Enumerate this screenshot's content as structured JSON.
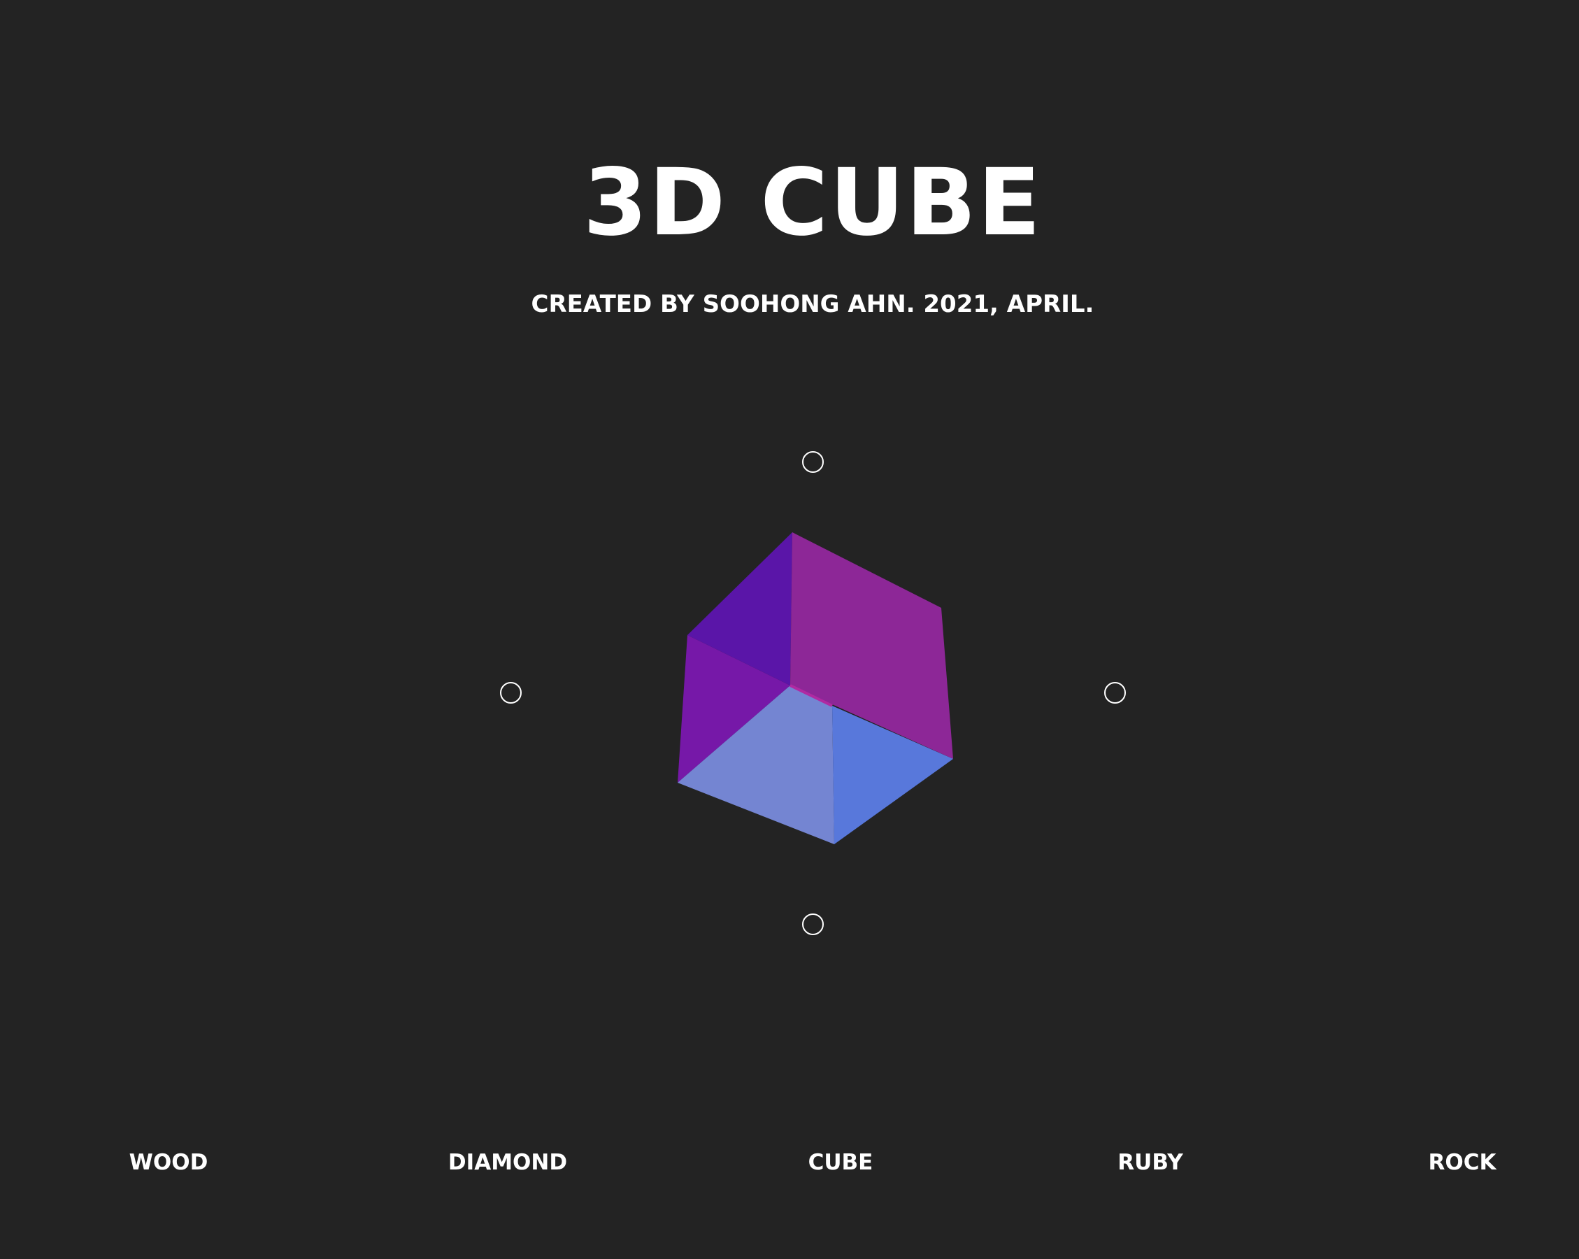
{
  "header": {
    "title": "3D CUBE",
    "subtitle": "CREATED BY SOOHONG AHN. 2021, APRIL."
  },
  "controls": [
    {
      "name": "rotate-up"
    },
    {
      "name": "rotate-left"
    },
    {
      "name": "rotate-right"
    },
    {
      "name": "rotate-down"
    }
  ],
  "cube": {
    "colors": {
      "top_left": "#5a15a8",
      "top_right": "#8d2797",
      "left_side": "#7618a8",
      "bottom_left": "#7485d2",
      "bottom_right": "#5878db",
      "edge_highlight": "#b02aa2"
    }
  },
  "menu": {
    "items": [
      "WOOD",
      "DIAMOND",
      "CUBE",
      "RUBY",
      "ROCK"
    ]
  },
  "colors": {
    "background": "#232323",
    "text": "#ffffff"
  }
}
